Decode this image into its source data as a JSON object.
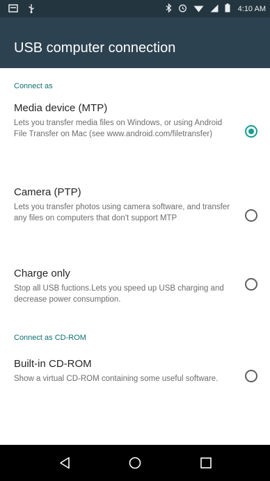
{
  "status_bar": {
    "time": "4:10 AM",
    "icons": [
      "notification-icon",
      "usb-icon",
      "bluetooth-icon",
      "alarm-icon",
      "wifi-icon",
      "signal-icon",
      "battery-icon"
    ]
  },
  "app_bar": {
    "title": "USB computer connection"
  },
  "sections": [
    {
      "header": "Connect as",
      "options": [
        {
          "title": "Media device (MTP)",
          "summary": "Lets you transfer media files on Windows, or using Android File Transfer on Mac (see www.android.com/filetransfer)",
          "checked": true
        },
        {
          "title": "Camera (PTP)",
          "summary": "Lets you transfer photos using camera software, and transfer any files on computers that don't support MTP",
          "checked": false
        },
        {
          "title": "Charge only",
          "summary": "Stop all USB fuctions.Lets you speed up USB charging and decrease power consumption.",
          "checked": false
        }
      ]
    },
    {
      "header": "Connect as CD-ROM",
      "options": [
        {
          "title": "Built-in CD-ROM",
          "summary": "Show a virtual CD-ROM containing some useful software.",
          "checked": false
        }
      ]
    }
  ],
  "nav_bar": {
    "icons": [
      "back-icon",
      "home-icon",
      "recents-icon"
    ]
  },
  "colors": {
    "status_bar": "#23353f",
    "app_bar": "#2d4250",
    "accent": "#169c92",
    "section_header": "#0b6f72"
  }
}
